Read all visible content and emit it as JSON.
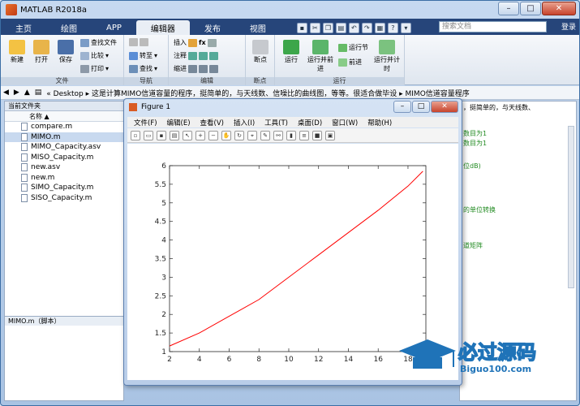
{
  "window": {
    "title": "MATLAB R2018a"
  },
  "tabs": [
    "主页",
    "绘图",
    "APP",
    "编辑器",
    "发布",
    "视图"
  ],
  "search": {
    "placeholder": "搜索文档"
  },
  "login": "登录",
  "ribbon": {
    "file": {
      "label": "文件",
      "new": "新建",
      "open": "打开",
      "save": "保存",
      "find_files": "查找文件",
      "compare": "比较",
      "print": "打印"
    },
    "nav": {
      "label": "导航",
      "goto": "转至",
      "find": "查找"
    },
    "edit": {
      "label": "编辑",
      "insert": "插入",
      "comment": "注释",
      "indent": "缩进",
      "fx": "fx"
    },
    "breakpoints": {
      "label": "断点",
      "breakpoint": "断点"
    },
    "run": {
      "label": "运行",
      "run": "运行",
      "run_advance": "运行并前进",
      "run_section": "运行节",
      "advance": "前进",
      "run_time": "运行并计时"
    }
  },
  "pathbar": {
    "path": "« Desktop ▸ 这是计算MIMO信道容量的程序，挺简单的，与天线数、信噪比的曲线图，等等。很适合做毕设 ▸ MIMO信道容量程序"
  },
  "left": {
    "header": "当前文件夹",
    "column": "名称 ▲",
    "files": [
      "compare.m",
      "MIMO.m",
      "MIMO_Capacity.asv",
      "MISO_Capacity.m",
      "new.asv",
      "new.m",
      "SIMO_Capacity.m",
      "SISO_Capacity.m"
    ],
    "detail": "MIMO.m（脚本）"
  },
  "right": {
    "snippets": [
      "，挺简单的，与天线数、",
      "数目为1",
      "数目为1",
      "位dB)",
      "的单位转换",
      "道矩阵"
    ]
  },
  "figure": {
    "title": "Figure 1",
    "menu": [
      "文件(F)",
      "编辑(E)",
      "查看(V)",
      "插入(I)",
      "工具(T)",
      "桌面(D)",
      "窗口(W)",
      "帮助(H)"
    ]
  },
  "chart_data": {
    "type": "line",
    "x": [
      2,
      4,
      6,
      8,
      10,
      12,
      14,
      16,
      18,
      19
    ],
    "values": [
      1.15,
      1.5,
      1.95,
      2.4,
      3.0,
      3.6,
      4.2,
      4.8,
      5.45,
      5.85
    ],
    "xlim": [
      2,
      19.2
    ],
    "ylim": [
      1,
      6
    ],
    "xticks": [
      2,
      4,
      6,
      8,
      10,
      12,
      14,
      16,
      18
    ],
    "yticks": [
      1,
      1.5,
      2,
      2.5,
      3,
      3.5,
      4,
      4.5,
      5,
      5.5,
      6
    ],
    "color": "#ff0000"
  },
  "watermark": {
    "title": "必过源码",
    "sub": "Biguo100.com"
  }
}
